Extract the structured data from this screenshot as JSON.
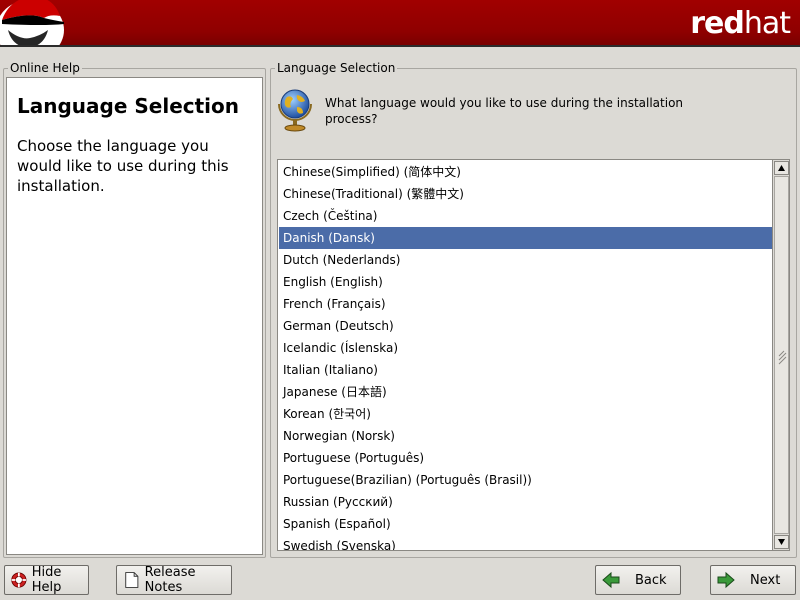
{
  "header": {
    "logo_alt": "Shadowman",
    "brand_bold": "red",
    "brand_regular": "hat",
    "colors": {
      "banner": "#a10000",
      "selection": "#4b6ca8"
    }
  },
  "help": {
    "frame_label": "Online Help",
    "title": "Language Selection",
    "text": "Choose the language you would like to use during this installation."
  },
  "language": {
    "frame_label": "Language Selection",
    "icon": "globe-icon",
    "question": "What language would you like to use during the installation process?",
    "selected": "Danish (Dansk)",
    "items": [
      "Chinese(Simplified) (简体中文)",
      "Chinese(Traditional) (繁體中文)",
      "Czech (Čeština)",
      "Danish (Dansk)",
      "Dutch (Nederlands)",
      "English (English)",
      "French (Français)",
      "German (Deutsch)",
      "Icelandic (Íslenska)",
      "Italian (Italiano)",
      "Japanese (日本語)",
      "Korean (한국어)",
      "Norwegian (Norsk)",
      "Portuguese (Português)",
      "Portuguese(Brazilian) (Português (Brasil))",
      "Russian (Русский)",
      "Spanish (Español)",
      "Swedish (Svenska)"
    ]
  },
  "buttons": {
    "hide_help": "Hide Help",
    "release_notes": "Release Notes",
    "back": "Back",
    "next": "Next"
  }
}
